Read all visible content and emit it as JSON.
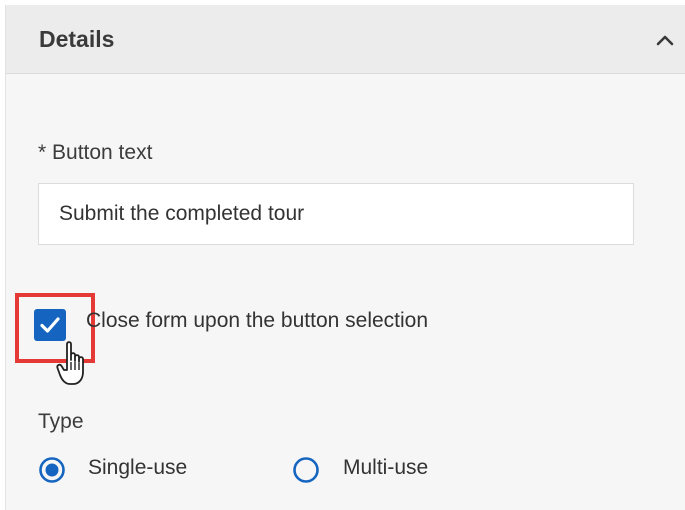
{
  "section": {
    "title": "Details",
    "collapse_icon": "chevron-up-icon"
  },
  "button_text_field": {
    "label": "* Button text",
    "value": "Submit the completed tour"
  },
  "close_form_checkbox": {
    "label": "Close form upon the button selection",
    "checked": true,
    "highlight_color": "#e53935"
  },
  "type_field": {
    "label": "Type",
    "options": [
      {
        "label": "Single-use",
        "selected": true
      },
      {
        "label": "Multi-use",
        "selected": false
      }
    ]
  },
  "colors": {
    "accent": "#1565c0",
    "header_bg": "#ececec",
    "panel_bg": "#f6f6f6"
  },
  "cursor": "hand-pointer-icon"
}
